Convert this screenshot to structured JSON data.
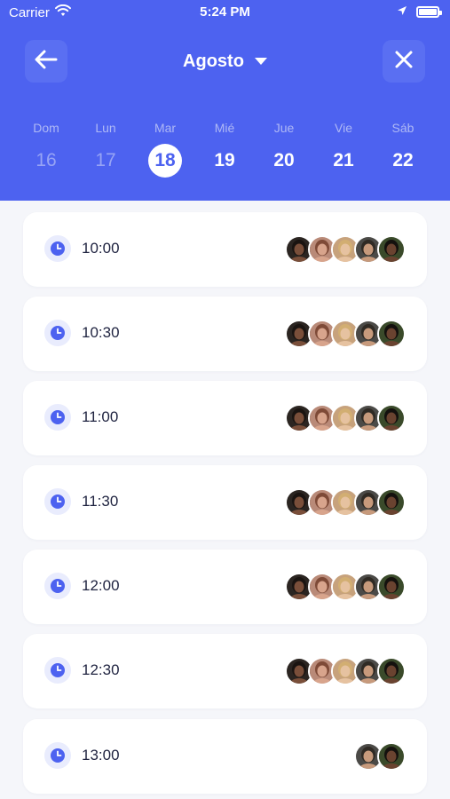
{
  "status": {
    "carrier": "Carrier",
    "time": "5:24 PM"
  },
  "header": {
    "month": "Agosto"
  },
  "week": [
    {
      "name": "Dom",
      "num": "16",
      "state": "past"
    },
    {
      "name": "Lun",
      "num": "17",
      "state": "past"
    },
    {
      "name": "Mar",
      "num": "18",
      "state": "selected"
    },
    {
      "name": "Mié",
      "num": "19",
      "state": "future"
    },
    {
      "name": "Jue",
      "num": "20",
      "state": "future"
    },
    {
      "name": "Vie",
      "num": "21",
      "state": "future"
    },
    {
      "name": "Sáb",
      "num": "22",
      "state": "future"
    }
  ],
  "slots": [
    {
      "time": "10:00",
      "avatars": [
        "p1",
        "p2",
        "p3",
        "p4",
        "p5"
      ]
    },
    {
      "time": "10:30",
      "avatars": [
        "p1",
        "p2",
        "p3",
        "p4",
        "p5"
      ]
    },
    {
      "time": "11:00",
      "avatars": [
        "p1",
        "p2",
        "p3",
        "p4",
        "p5"
      ]
    },
    {
      "time": "11:30",
      "avatars": [
        "p1",
        "p2",
        "p3",
        "p4",
        "p5"
      ]
    },
    {
      "time": "12:00",
      "avatars": [
        "p1",
        "p2",
        "p3",
        "p4",
        "p5"
      ]
    },
    {
      "time": "12:30",
      "avatars": [
        "p1",
        "p2",
        "p3",
        "p4",
        "p5"
      ]
    },
    {
      "time": "13:00",
      "avatars": [
        "p4",
        "p5"
      ]
    }
  ],
  "colors": {
    "primary": "#4d62f0",
    "background": "#f5f6fa",
    "card": "#ffffff"
  },
  "icons": [
    "wifi-icon",
    "location-icon",
    "battery-icon",
    "back-arrow-icon",
    "caret-down-icon",
    "close-icon",
    "clock-icon",
    "avatar"
  ]
}
